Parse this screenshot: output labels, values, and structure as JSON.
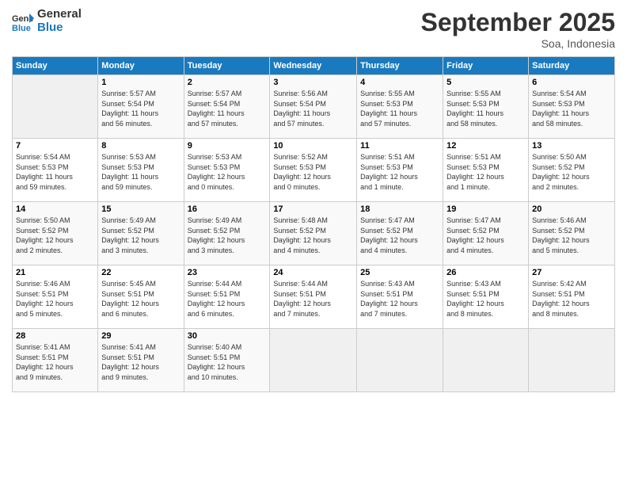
{
  "header": {
    "logo_line1": "General",
    "logo_line2": "Blue",
    "month_title": "September 2025",
    "subtitle": "Soa, Indonesia"
  },
  "days_of_week": [
    "Sunday",
    "Monday",
    "Tuesday",
    "Wednesday",
    "Thursday",
    "Friday",
    "Saturday"
  ],
  "weeks": [
    [
      {
        "day": "",
        "info": ""
      },
      {
        "day": "1",
        "info": "Sunrise: 5:57 AM\nSunset: 5:54 PM\nDaylight: 11 hours\nand 56 minutes."
      },
      {
        "day": "2",
        "info": "Sunrise: 5:57 AM\nSunset: 5:54 PM\nDaylight: 11 hours\nand 57 minutes."
      },
      {
        "day": "3",
        "info": "Sunrise: 5:56 AM\nSunset: 5:54 PM\nDaylight: 11 hours\nand 57 minutes."
      },
      {
        "day": "4",
        "info": "Sunrise: 5:55 AM\nSunset: 5:53 PM\nDaylight: 11 hours\nand 57 minutes."
      },
      {
        "day": "5",
        "info": "Sunrise: 5:55 AM\nSunset: 5:53 PM\nDaylight: 11 hours\nand 58 minutes."
      },
      {
        "day": "6",
        "info": "Sunrise: 5:54 AM\nSunset: 5:53 PM\nDaylight: 11 hours\nand 58 minutes."
      }
    ],
    [
      {
        "day": "7",
        "info": "Sunrise: 5:54 AM\nSunset: 5:53 PM\nDaylight: 11 hours\nand 59 minutes."
      },
      {
        "day": "8",
        "info": "Sunrise: 5:53 AM\nSunset: 5:53 PM\nDaylight: 11 hours\nand 59 minutes."
      },
      {
        "day": "9",
        "info": "Sunrise: 5:53 AM\nSunset: 5:53 PM\nDaylight: 12 hours\nand 0 minutes."
      },
      {
        "day": "10",
        "info": "Sunrise: 5:52 AM\nSunset: 5:53 PM\nDaylight: 12 hours\nand 0 minutes."
      },
      {
        "day": "11",
        "info": "Sunrise: 5:51 AM\nSunset: 5:53 PM\nDaylight: 12 hours\nand 1 minute."
      },
      {
        "day": "12",
        "info": "Sunrise: 5:51 AM\nSunset: 5:53 PM\nDaylight: 12 hours\nand 1 minute."
      },
      {
        "day": "13",
        "info": "Sunrise: 5:50 AM\nSunset: 5:52 PM\nDaylight: 12 hours\nand 2 minutes."
      }
    ],
    [
      {
        "day": "14",
        "info": "Sunrise: 5:50 AM\nSunset: 5:52 PM\nDaylight: 12 hours\nand 2 minutes."
      },
      {
        "day": "15",
        "info": "Sunrise: 5:49 AM\nSunset: 5:52 PM\nDaylight: 12 hours\nand 3 minutes."
      },
      {
        "day": "16",
        "info": "Sunrise: 5:49 AM\nSunset: 5:52 PM\nDaylight: 12 hours\nand 3 minutes."
      },
      {
        "day": "17",
        "info": "Sunrise: 5:48 AM\nSunset: 5:52 PM\nDaylight: 12 hours\nand 4 minutes."
      },
      {
        "day": "18",
        "info": "Sunrise: 5:47 AM\nSunset: 5:52 PM\nDaylight: 12 hours\nand 4 minutes."
      },
      {
        "day": "19",
        "info": "Sunrise: 5:47 AM\nSunset: 5:52 PM\nDaylight: 12 hours\nand 4 minutes."
      },
      {
        "day": "20",
        "info": "Sunrise: 5:46 AM\nSunset: 5:52 PM\nDaylight: 12 hours\nand 5 minutes."
      }
    ],
    [
      {
        "day": "21",
        "info": "Sunrise: 5:46 AM\nSunset: 5:51 PM\nDaylight: 12 hours\nand 5 minutes."
      },
      {
        "day": "22",
        "info": "Sunrise: 5:45 AM\nSunset: 5:51 PM\nDaylight: 12 hours\nand 6 minutes."
      },
      {
        "day": "23",
        "info": "Sunrise: 5:44 AM\nSunset: 5:51 PM\nDaylight: 12 hours\nand 6 minutes."
      },
      {
        "day": "24",
        "info": "Sunrise: 5:44 AM\nSunset: 5:51 PM\nDaylight: 12 hours\nand 7 minutes."
      },
      {
        "day": "25",
        "info": "Sunrise: 5:43 AM\nSunset: 5:51 PM\nDaylight: 12 hours\nand 7 minutes."
      },
      {
        "day": "26",
        "info": "Sunrise: 5:43 AM\nSunset: 5:51 PM\nDaylight: 12 hours\nand 8 minutes."
      },
      {
        "day": "27",
        "info": "Sunrise: 5:42 AM\nSunset: 5:51 PM\nDaylight: 12 hours\nand 8 minutes."
      }
    ],
    [
      {
        "day": "28",
        "info": "Sunrise: 5:41 AM\nSunset: 5:51 PM\nDaylight: 12 hours\nand 9 minutes."
      },
      {
        "day": "29",
        "info": "Sunrise: 5:41 AM\nSunset: 5:51 PM\nDaylight: 12 hours\nand 9 minutes."
      },
      {
        "day": "30",
        "info": "Sunrise: 5:40 AM\nSunset: 5:51 PM\nDaylight: 12 hours\nand 10 minutes."
      },
      {
        "day": "",
        "info": ""
      },
      {
        "day": "",
        "info": ""
      },
      {
        "day": "",
        "info": ""
      },
      {
        "day": "",
        "info": ""
      }
    ]
  ]
}
